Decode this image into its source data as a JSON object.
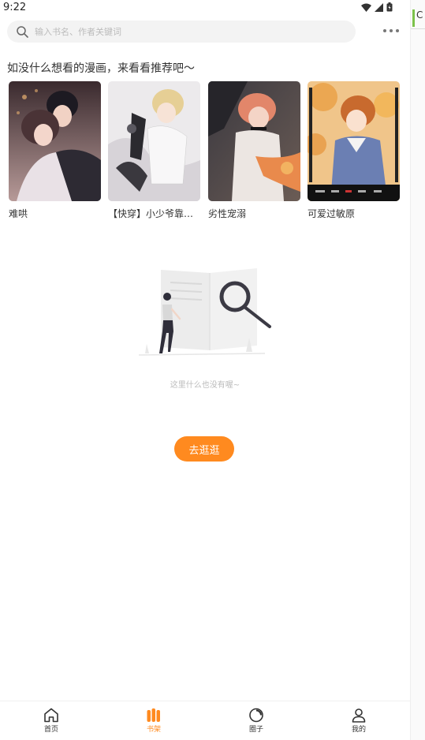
{
  "status_bar": {
    "time": "9:22"
  },
  "side_strip": {
    "label": "C"
  },
  "search": {
    "placeholder": "输入书名、作者关键词"
  },
  "recommend": {
    "title": "如没什么想看的漫画，来看看推荐吧～",
    "items": [
      {
        "name": "难哄"
      },
      {
        "name": "【快穿】小少爷靠美…"
      },
      {
        "name": "劣性宠溺"
      },
      {
        "name": "可爱过敏原"
      }
    ]
  },
  "empty": {
    "text": "这里什么也没有喔~",
    "button_label": "去逛逛"
  },
  "tabbar": {
    "items": [
      {
        "label": "首页",
        "icon": "home-icon"
      },
      {
        "label": "书架",
        "icon": "bookshelf-icon"
      },
      {
        "label": "圈子",
        "icon": "circle-icon"
      },
      {
        "label": "我的",
        "icon": "profile-icon"
      }
    ],
    "active_color": "#ff8a1f"
  }
}
